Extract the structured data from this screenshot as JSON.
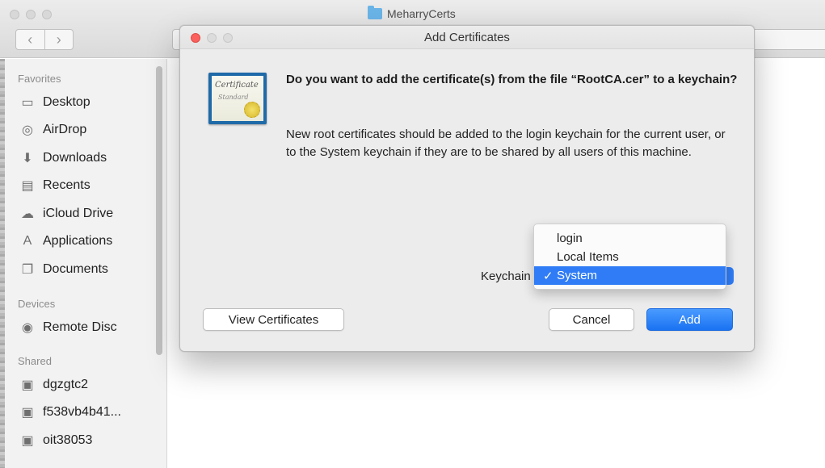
{
  "finder": {
    "title": "MeharryCerts",
    "nav": {
      "back": "‹",
      "forward": "›"
    },
    "sidebar": {
      "favorites_heading": "Favorites",
      "favorites": [
        {
          "label": "Desktop",
          "icon": "desktop-icon",
          "glyph": "▭"
        },
        {
          "label": "AirDrop",
          "icon": "airdrop-icon",
          "glyph": "◎"
        },
        {
          "label": "Downloads",
          "icon": "downloads-icon",
          "glyph": "⬇"
        },
        {
          "label": "Recents",
          "icon": "recents-icon",
          "glyph": "▤"
        },
        {
          "label": "iCloud Drive",
          "icon": "cloud-icon",
          "glyph": "☁"
        },
        {
          "label": "Applications",
          "icon": "applications-icon",
          "glyph": "A"
        },
        {
          "label": "Documents",
          "icon": "documents-icon",
          "glyph": "❐"
        }
      ],
      "devices_heading": "Devices",
      "devices": [
        {
          "label": "Remote Disc",
          "icon": "disc-icon",
          "glyph": "◉"
        }
      ],
      "shared_heading": "Shared",
      "shared": [
        {
          "label": "dgzgtc2",
          "icon": "computer-icon",
          "glyph": "▣"
        },
        {
          "label": "f538vb4b41...",
          "icon": "computer-icon",
          "glyph": "▣"
        },
        {
          "label": "oit38053",
          "icon": "computer-icon",
          "glyph": "▣"
        }
      ]
    }
  },
  "dialog": {
    "title": "Add Certificates",
    "cert_icon_text": {
      "line1": "Certificate",
      "line2": "Standard"
    },
    "question": "Do you want to add the certificate(s) from the file “RootCA.cer” to a keychain?",
    "info": "New root certificates should be added to the login keychain for the current user, or to the System keychain if they are to be shared by all users of this machine.",
    "keychain_label": "Keychain",
    "keychain_options": [
      "login",
      "Local Items",
      "System"
    ],
    "selected_option": "System",
    "check_mark": "✓",
    "popup_arrows": "⇕",
    "buttons": {
      "view": "View Certificates",
      "cancel": "Cancel",
      "add": "Add"
    }
  },
  "colors": {
    "accent": "#2f7cf6",
    "close_button": "#fc605c"
  }
}
